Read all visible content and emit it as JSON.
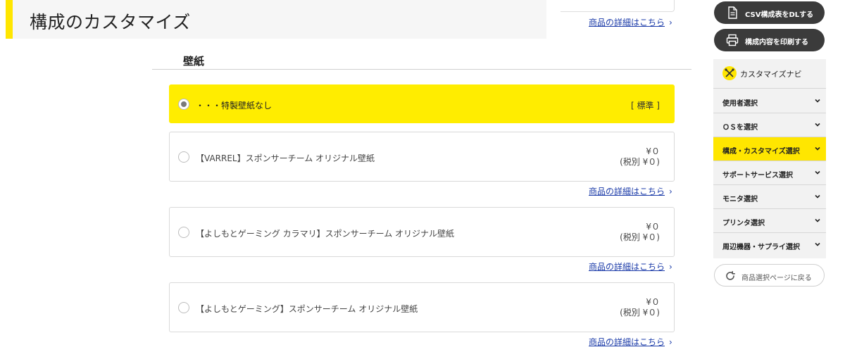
{
  "page": {
    "title": "構成のカスタマイズ",
    "section_title": "壁紙",
    "detail_link_text": "商品の詳細はこちら"
  },
  "options": [
    {
      "label": "・・・特製壁紙なし",
      "standard_tag": "[ 標準 ]",
      "selected": true
    },
    {
      "label": "【VARREL】スポンサーチーム オリジナル壁紙",
      "price": "¥０",
      "price_excl": "(税別 ¥０)",
      "selected": false
    },
    {
      "label": "【よしもとゲーミング カラマリ】スポンサーチーム オリジナル壁紙",
      "price": "¥０",
      "price_excl": "(税別 ¥０)",
      "selected": false
    },
    {
      "label": "【よしもとゲーミング】スポンサーチーム オリジナル壁紙",
      "price": "¥０",
      "price_excl": "(税別 ¥０)",
      "selected": false
    }
  ],
  "sidebar": {
    "csv_button": "CSV構成表をDLする",
    "print_button": "構成内容を印刷する",
    "navi_title": "カスタマイズナビ",
    "nav_items": [
      {
        "label": "使用者選択",
        "active": false
      },
      {
        "label": "ＯＳを選択",
        "active": false
      },
      {
        "label": "構成・カスタマイズ選択",
        "active": true
      },
      {
        "label": "サポートサービス選択",
        "active": false
      },
      {
        "label": "モニタ選択",
        "active": false
      },
      {
        "label": "プリンタ選択",
        "active": false
      },
      {
        "label": "周辺機器・サプライ選択",
        "active": false
      }
    ],
    "back_button": "商品選択ページに戻る"
  },
  "colors": {
    "accent_yellow": "#ffe600",
    "link_blue": "#1a3aa8",
    "dark_button": "#3b3b3b"
  }
}
